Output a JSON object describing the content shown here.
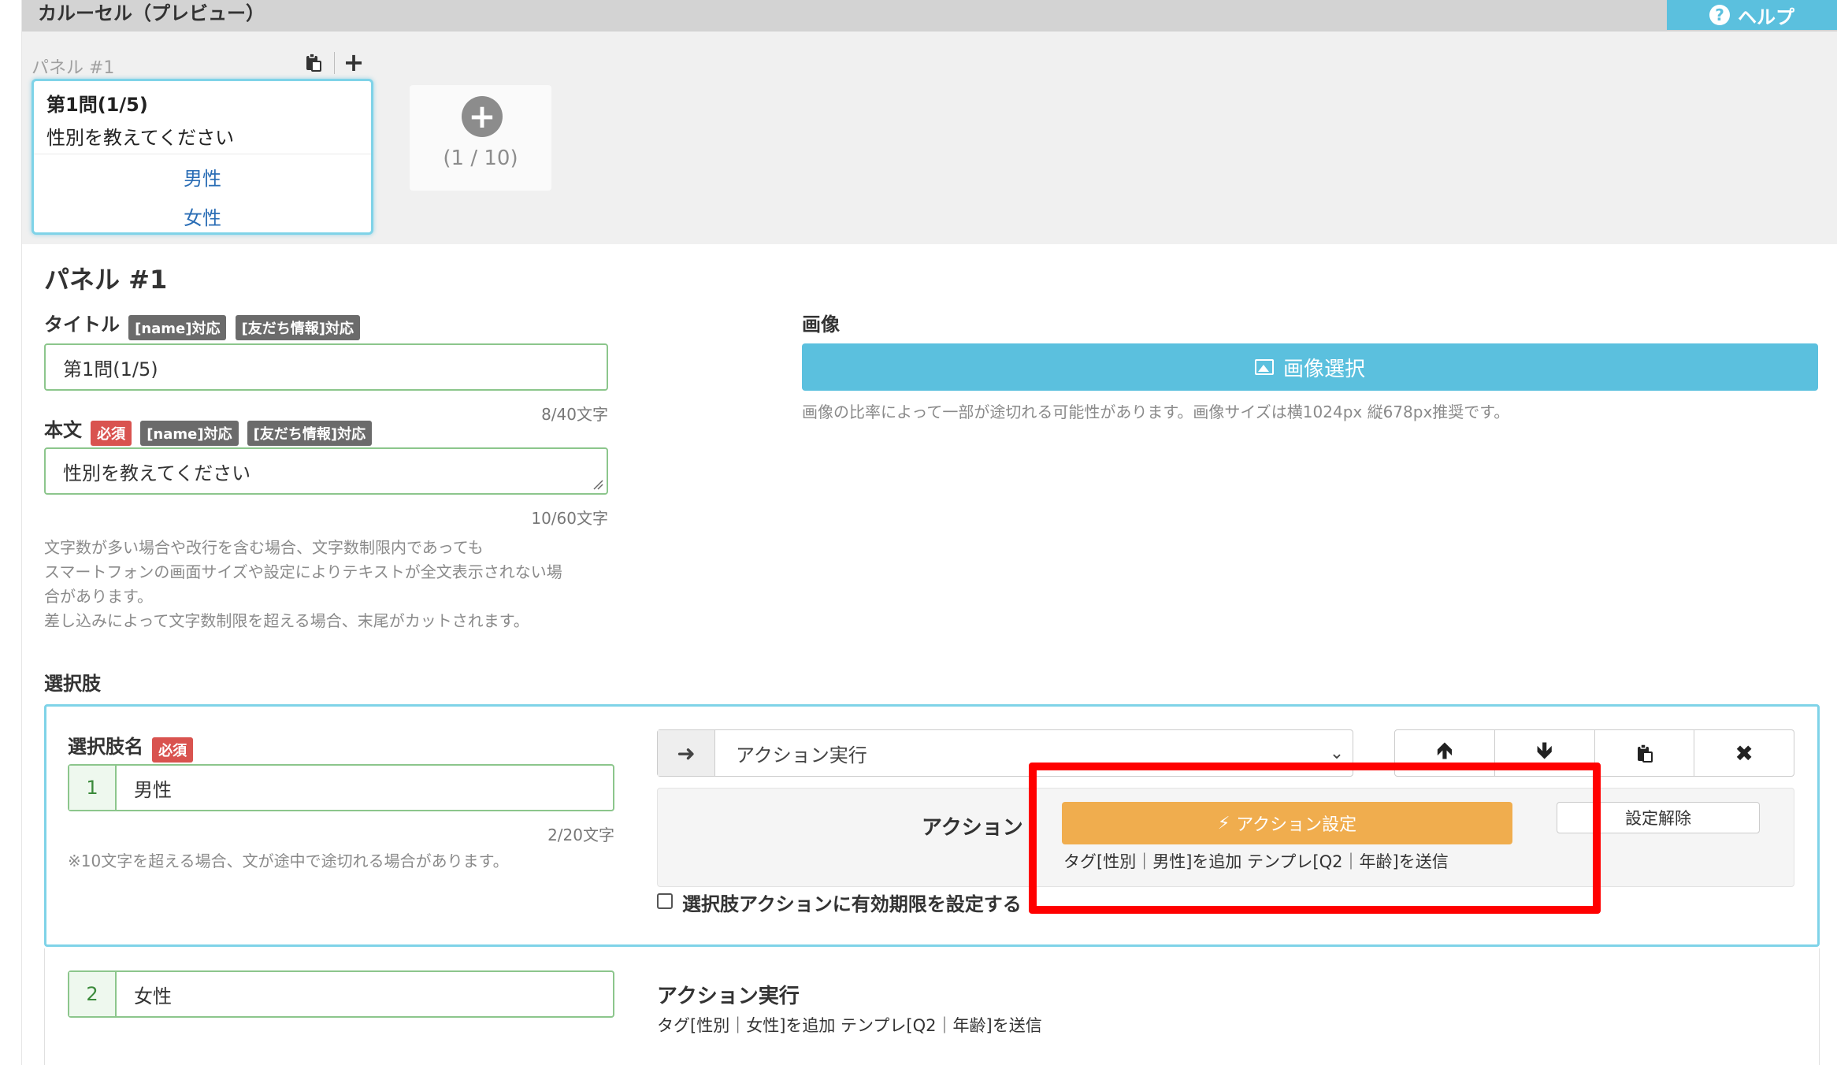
{
  "header": {
    "title": "カルーセル（プレビュー）",
    "help_label": "ヘルプ",
    "help_icon": "question-circle-icon"
  },
  "preview": {
    "panel_label": "パネル #1",
    "card": {
      "title": "第1問(1/5)",
      "body": "性別を教えてください",
      "options": [
        "男性",
        "女性"
      ]
    },
    "add_count": "(1 / 10)"
  },
  "editor": {
    "panel_heading": "パネル #1",
    "title_label": "タイトル",
    "title_badges": [
      "[name]対応",
      "[友だち情報]対応"
    ],
    "title_value": "第1問(1/5)",
    "title_count": "8/40文字",
    "body_label": "本文",
    "body_badges": [
      "必須",
      "[name]対応",
      "[友だち情報]対応"
    ],
    "body_value": "性別を教えてください",
    "body_count": "10/60文字",
    "body_hint": [
      "文字数が多い場合や改行を含む場合、文字数制限内であっても",
      "スマートフォンの画面サイズや設定によりテキストが全文表示されない場",
      "合があります。",
      "差し込みによって文字数制限を超える場合、末尾がカットされます。"
    ],
    "image_label": "画像",
    "image_button": "画像選択",
    "image_hint": "画像の比率によって一部が途切れる可能性があります。画像サイズは横1024px 縦678px推奨です。"
  },
  "choices": {
    "heading": "選択肢",
    "name_label": "選択肢名",
    "required_badge": "必須",
    "items": [
      {
        "number": "1",
        "value": "男性",
        "count": "2/20文字",
        "hint": "※10文字を超える場合、文が途中で途切れる場合があります。",
        "action_type": "アクション実行",
        "action_label": "アクション",
        "action_button": "アクション設定",
        "action_desc": "タグ[性別｜男性]を追加 テンプレ[Q2｜年齢]を送信",
        "clear_button": "設定解除",
        "expiry_label": "選択肢アクションに有効期限を設定する"
      },
      {
        "number": "2",
        "value": "女性",
        "action_title": "アクション実行",
        "action_desc": "タグ[性別｜女性]を追加 テンプレ[Q2｜年齢]を送信"
      }
    ]
  },
  "colors": {
    "accent": "#5bc0de",
    "warning": "#f0ad4e",
    "danger": "#d9534f",
    "highlight": "#ff0000"
  }
}
